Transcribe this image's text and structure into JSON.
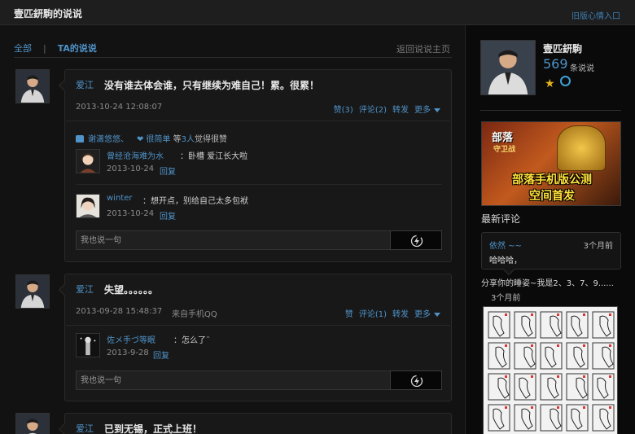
{
  "header": {
    "title": "壹匹鈃駒的说说",
    "old_entry": "旧版心情入口"
  },
  "filters": {
    "all": "全部",
    "separator": "|",
    "ta": "TA的说说",
    "back": "返回说说主页"
  },
  "posts": [
    {
      "author": "爱江",
      "text": "没有谁去体会谁，只有继续为难自己！累。很累！",
      "time": "2013-10-24 12:08:07",
      "source": "",
      "actions": {
        "like": "赞(3)",
        "comment": "评论(2)",
        "forward": "转发",
        "more": "更多"
      },
      "likes": {
        "user1": "谢潇悠悠、",
        "user2": "很简单",
        "count_prefix": "等",
        "count": "3人",
        "suffix": "觉得很赞"
      },
      "comments": [
        {
          "name": "曾经沧海难为水",
          "text": "：卧槽 爱江长大啦",
          "date": "2013-10-24",
          "reply": "回复"
        },
        {
          "name": "winter",
          "text": "：想开点，别给自己太多包袱",
          "date": "2013-10-24",
          "reply": "回复"
        }
      ],
      "input_placeholder": "我也说一句"
    },
    {
      "author": "爱江",
      "text": "失望。。。。。。",
      "time": "2013-09-28 15:48:37",
      "source": "来自手机QQ",
      "actions": {
        "like": "赞",
        "comment": "评论(1)",
        "forward": "转发",
        "more": "更多"
      },
      "comments": [
        {
          "name": "佐メ手づ等眠",
          "text": "：怎么了¨",
          "date": "2013-9-28",
          "reply": "回复"
        }
      ],
      "input_placeholder": "我也说一句"
    },
    {
      "author": "爱江",
      "text": "已到无锡，正式上班！"
    }
  ],
  "profile": {
    "name": "壹匹鈃駒",
    "count": "569",
    "count_label": "条说说"
  },
  "banner": {
    "logo": "部落",
    "logo_sub": "守卫战",
    "line1": "部落手机版公测",
    "line2": "空间首发"
  },
  "latest": {
    "title": "最新评论",
    "name": "依然 ~~",
    "time": "3个月前",
    "content": "哈哈哈，",
    "share_text": "分享你的睡姿~我是2、3、7、9......",
    "share_time": "3个月前"
  },
  "colors": {
    "link": "#4f93c9",
    "background": "#0d0d0d",
    "panel": "#181818",
    "star": "#e8b420"
  }
}
